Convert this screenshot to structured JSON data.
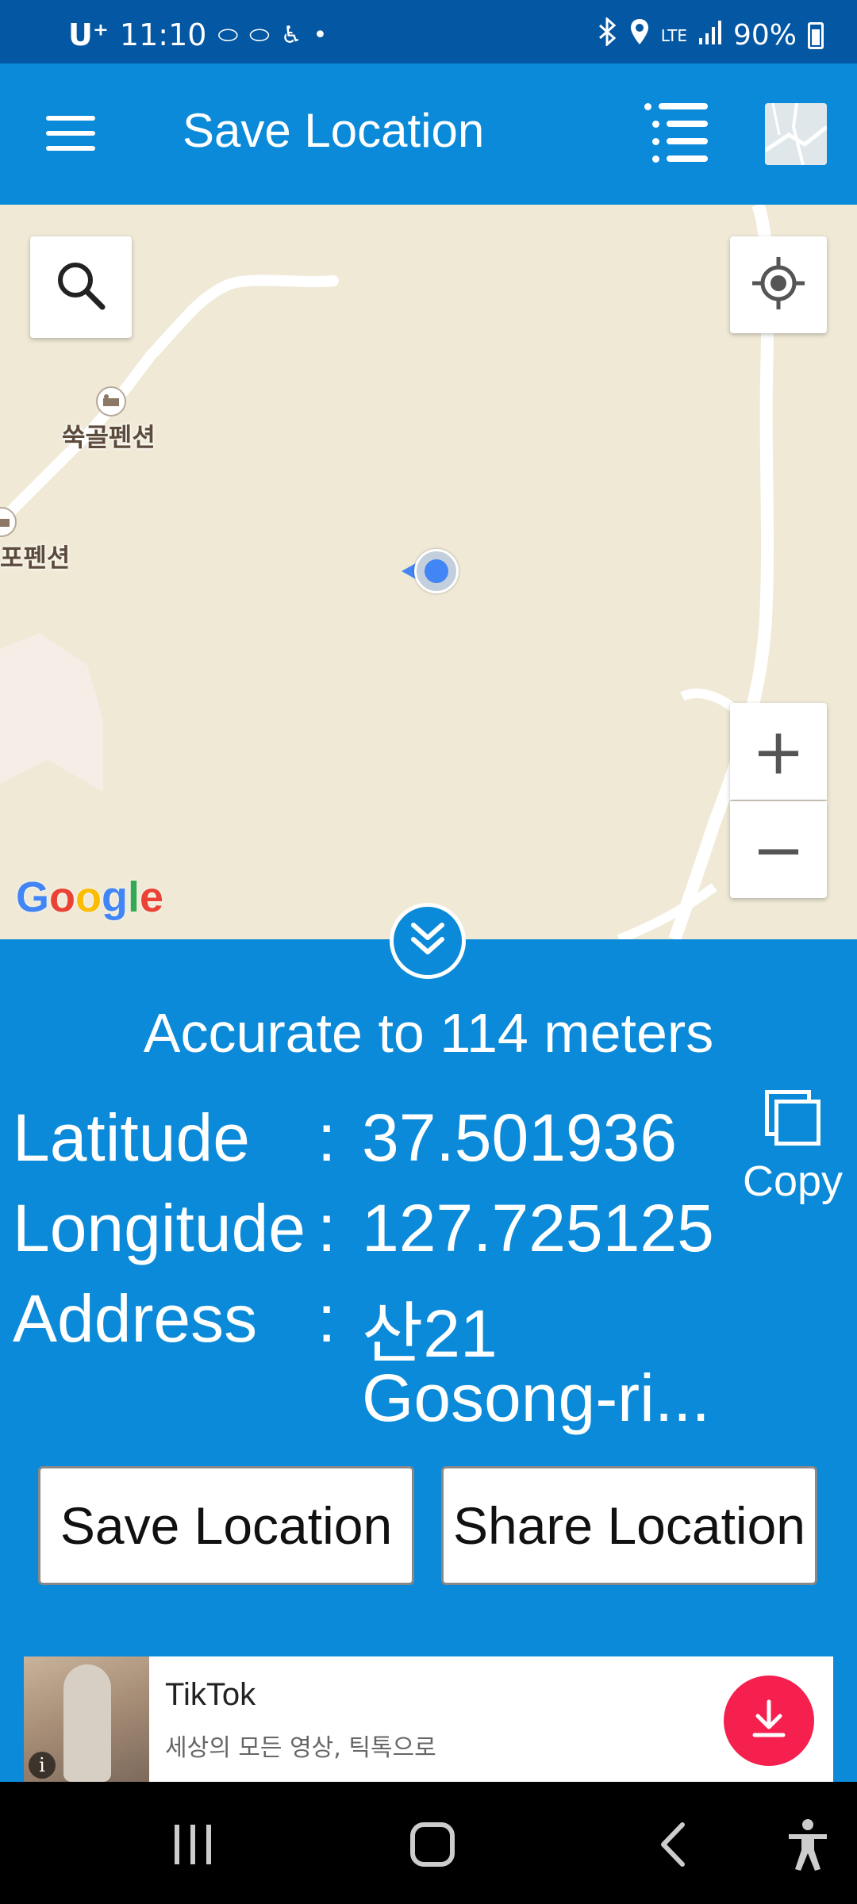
{
  "status_bar": {
    "carrier": "U⁺",
    "time": "11:10",
    "battery": "90%",
    "network": "LTE"
  },
  "app_bar": {
    "title": "Save Location",
    "icons": [
      "menu-icon",
      "saved-list-icon",
      "map-type-icon"
    ]
  },
  "map": {
    "places": [
      "쑥골펜션",
      "포펜션"
    ],
    "provider": "Google",
    "controls": [
      "search-icon",
      "my-location-icon",
      "zoom-in-icon",
      "zoom-out-icon"
    ],
    "zoom_in_label": "+",
    "zoom_out_label": "−"
  },
  "info": {
    "accuracy": "Accurate to 114 meters",
    "latitude_label": "Latitude",
    "latitude_value": "37.501936",
    "longitude_label": "Longitude",
    "longitude_value": "127.725125",
    "address_label": "Address",
    "address_line1": "산21",
    "address_line2": "Gosong-ri...",
    "colon": ":",
    "copy_label": "Copy"
  },
  "actions": {
    "save_label": "Save Location",
    "share_label": "Share Location"
  },
  "ad": {
    "title": "TikTok",
    "subtitle": "세상의 모든 영상, 틱톡으로",
    "info_glyph": "i"
  },
  "colors": {
    "app_bar": "#0a8ad8",
    "status_bar": "#0457a2",
    "map_land": "#efe9d6",
    "ad_download": "#f5204e"
  }
}
